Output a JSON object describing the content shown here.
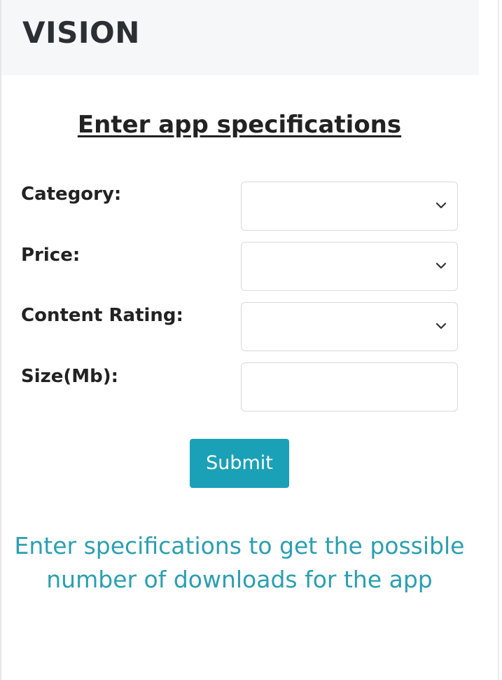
{
  "header": {
    "brand": "VISION"
  },
  "form": {
    "title": "Enter app specifications",
    "fields": [
      {
        "label": "Category:",
        "type": "select",
        "value": ""
      },
      {
        "label": "Price:",
        "type": "select",
        "value": ""
      },
      {
        "label": "Content Rating:",
        "type": "select",
        "value": ""
      },
      {
        "label": "Size(Mb):",
        "type": "text",
        "value": ""
      }
    ],
    "submit_label": "Submit"
  },
  "result": {
    "line1": "Enter specifications to get the possible",
    "line2": "number of downloads for the app"
  },
  "icons": {
    "select_indicator": "chevron-down-icon"
  },
  "colors": {
    "header_bg": "#f6f7f9",
    "button": "#1aa1b7",
    "result_text": "#2a9fb2",
    "field_border": "#d9dadd"
  }
}
